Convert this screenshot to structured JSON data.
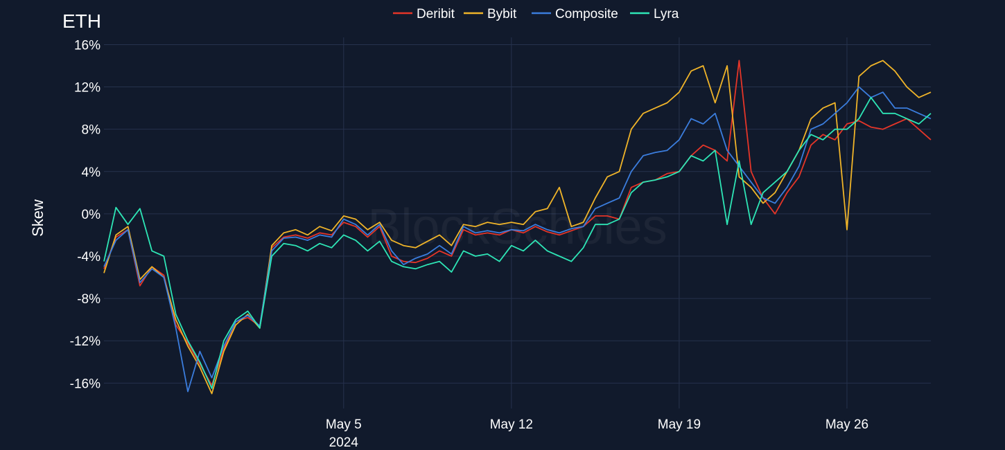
{
  "chart_data": {
    "type": "line",
    "title": "ETH",
    "ylabel": "Skew",
    "xlabel": "",
    "watermark": "BlockScholes",
    "yticks": [
      16,
      12,
      8,
      4,
      0,
      -4,
      -8,
      -12,
      -16
    ],
    "ytick_labels": [
      "16%",
      "12%",
      "8%",
      "4%",
      "0%",
      "-4%",
      "-8%",
      "-12%",
      "-16%"
    ],
    "ylim": [
      -18.4,
      17.6
    ],
    "xlim": [
      "2024-04-25",
      "2024-05-29 12:00"
    ],
    "xticks": [
      {
        "date": "2024-05-05",
        "label": "May 5",
        "sublabel": "2024"
      },
      {
        "date": "2024-05-12",
        "label": "May 12",
        "sublabel": ""
      },
      {
        "date": "2024-05-19",
        "label": "May 19",
        "sublabel": ""
      },
      {
        "date": "2024-05-26",
        "label": "May 26",
        "sublabel": ""
      }
    ],
    "grid": true,
    "legend_position": "top-center",
    "colors": {
      "background": "#111a2c",
      "grid": "#26324d",
      "text": "#ffffff"
    },
    "series": [
      {
        "name": "Deribit",
        "color": "#e53528",
        "x": [
          "2024-04-25",
          "2024-04-25 12:00",
          "2024-04-26",
          "2024-04-26 12:00",
          "2024-04-27",
          "2024-04-27 12:00",
          "2024-04-28",
          "2024-04-28 12:00",
          "2024-04-29",
          "2024-04-29 12:00",
          "2024-04-30",
          "2024-04-30 12:00",
          "2024-05-01",
          "2024-05-01 12:00",
          "2024-05-02",
          "2024-05-02 12:00",
          "2024-05-03",
          "2024-05-03 12:00",
          "2024-05-04",
          "2024-05-04 12:00",
          "2024-05-05",
          "2024-05-05 12:00",
          "2024-05-06",
          "2024-05-06 12:00",
          "2024-05-07",
          "2024-05-07 12:00",
          "2024-05-08",
          "2024-05-08 12:00",
          "2024-05-09",
          "2024-05-09 12:00",
          "2024-05-10",
          "2024-05-10 12:00",
          "2024-05-11",
          "2024-05-11 12:00",
          "2024-05-12",
          "2024-05-12 12:00",
          "2024-05-13",
          "2024-05-13 12:00",
          "2024-05-14",
          "2024-05-14 12:00",
          "2024-05-15",
          "2024-05-15 12:00",
          "2024-05-16",
          "2024-05-16 12:00",
          "2024-05-17",
          "2024-05-17 12:00",
          "2024-05-18",
          "2024-05-18 12:00",
          "2024-05-19",
          "2024-05-19 12:00",
          "2024-05-20",
          "2024-05-20 12:00",
          "2024-05-21",
          "2024-05-21 12:00",
          "2024-05-22",
          "2024-05-22 12:00",
          "2024-05-23",
          "2024-05-23 12:00",
          "2024-05-24",
          "2024-05-24 12:00",
          "2024-05-25",
          "2024-05-25 12:00",
          "2024-05-26",
          "2024-05-26 12:00",
          "2024-05-27",
          "2024-05-27 12:00",
          "2024-05-28",
          "2024-05-28 12:00",
          "2024-05-29",
          "2024-05-29 12:00"
        ],
        "values": [
          -5.2,
          -2.2,
          -1.5,
          -6.8,
          -5.0,
          -5.8,
          -10.5,
          -12.2,
          -14.2,
          -16.2,
          -12.8,
          -10.2,
          -9.8,
          -10.6,
          -3.2,
          -2.2,
          -2.0,
          -2.3,
          -1.8,
          -2.0,
          -0.8,
          -1.2,
          -2.2,
          -1.2,
          -4.0,
          -4.5,
          -4.6,
          -4.2,
          -3.5,
          -4.0,
          -1.5,
          -2.0,
          -1.8,
          -2.0,
          -1.5,
          -1.8,
          -1.2,
          -1.7,
          -2.0,
          -1.6,
          -1.2,
          -0.2,
          -0.2,
          -0.5,
          2.5,
          3.0,
          3.2,
          3.8,
          4.0,
          5.5,
          6.5,
          6.0,
          5.0,
          14.5,
          4.0,
          1.5,
          0.0,
          2.0,
          3.5,
          6.5,
          7.5,
          7.0,
          8.5,
          8.8,
          8.2,
          8.0,
          8.5,
          9.0,
          8.0,
          7.0
        ]
      },
      {
        "name": "Bybit",
        "color": "#f0b429",
        "x": [
          "2024-04-25",
          "2024-04-25 12:00",
          "2024-04-26",
          "2024-04-26 12:00",
          "2024-04-27",
          "2024-04-27 12:00",
          "2024-04-28",
          "2024-04-28 12:00",
          "2024-04-29",
          "2024-04-29 12:00",
          "2024-04-30",
          "2024-04-30 12:00",
          "2024-05-01",
          "2024-05-01 12:00",
          "2024-05-02",
          "2024-05-02 12:00",
          "2024-05-03",
          "2024-05-03 12:00",
          "2024-05-04",
          "2024-05-04 12:00",
          "2024-05-05",
          "2024-05-05 12:00",
          "2024-05-06",
          "2024-05-06 12:00",
          "2024-05-07",
          "2024-05-07 12:00",
          "2024-05-08",
          "2024-05-08 12:00",
          "2024-05-09",
          "2024-05-09 12:00",
          "2024-05-10",
          "2024-05-10 12:00",
          "2024-05-11",
          "2024-05-11 12:00",
          "2024-05-12",
          "2024-05-12 12:00",
          "2024-05-13",
          "2024-05-13 12:00",
          "2024-05-14",
          "2024-05-14 12:00",
          "2024-05-15",
          "2024-05-15 12:00",
          "2024-05-16",
          "2024-05-16 12:00",
          "2024-05-17",
          "2024-05-17 12:00",
          "2024-05-18",
          "2024-05-18 12:00",
          "2024-05-19",
          "2024-05-19 12:00",
          "2024-05-20",
          "2024-05-20 12:00",
          "2024-05-21",
          "2024-05-21 12:00",
          "2024-05-22",
          "2024-05-22 12:00",
          "2024-05-23",
          "2024-05-23 12:00",
          "2024-05-24",
          "2024-05-24 12:00",
          "2024-05-25",
          "2024-05-25 12:00",
          "2024-05-26",
          "2024-05-26 12:00",
          "2024-05-27",
          "2024-05-27 12:00",
          "2024-05-28",
          "2024-05-28 12:00",
          "2024-05-29",
          "2024-05-29 12:00"
        ],
        "values": [
          -5.6,
          -2.0,
          -1.2,
          -6.2,
          -5.0,
          -6.0,
          -10.0,
          -12.5,
          -14.5,
          -17.0,
          -13.0,
          -10.5,
          -9.5,
          -10.8,
          -3.0,
          -1.8,
          -1.5,
          -2.0,
          -1.2,
          -1.6,
          -0.2,
          -0.5,
          -1.5,
          -0.8,
          -2.5,
          -3.0,
          -3.2,
          -2.6,
          -2.0,
          -3.0,
          -1.0,
          -1.2,
          -0.8,
          -1.0,
          -0.8,
          -1.0,
          0.2,
          0.5,
          2.5,
          -1.2,
          -0.8,
          1.5,
          3.5,
          4.0,
          8.0,
          9.5,
          10.0,
          10.5,
          11.5,
          13.5,
          14.0,
          10.5,
          14.0,
          3.5,
          2.5,
          1.0,
          2.0,
          4.0,
          6.0,
          9.0,
          10.0,
          10.5,
          -1.5,
          13.0,
          14.0,
          14.5,
          13.5,
          12.0,
          11.0,
          11.5
        ]
      },
      {
        "name": "Composite",
        "color": "#3b7ddd",
        "x": [
          "2024-04-25",
          "2024-04-25 12:00",
          "2024-04-26",
          "2024-04-26 12:00",
          "2024-04-27",
          "2024-04-27 12:00",
          "2024-04-28",
          "2024-04-28 12:00",
          "2024-04-29",
          "2024-04-29 12:00",
          "2024-04-30",
          "2024-04-30 12:00",
          "2024-05-01",
          "2024-05-01 12:00",
          "2024-05-02",
          "2024-05-02 12:00",
          "2024-05-03",
          "2024-05-03 12:00",
          "2024-05-04",
          "2024-05-04 12:00",
          "2024-05-05",
          "2024-05-05 12:00",
          "2024-05-06",
          "2024-05-06 12:00",
          "2024-05-07",
          "2024-05-07 12:00",
          "2024-05-08",
          "2024-05-08 12:00",
          "2024-05-09",
          "2024-05-09 12:00",
          "2024-05-10",
          "2024-05-10 12:00",
          "2024-05-11",
          "2024-05-11 12:00",
          "2024-05-12",
          "2024-05-12 12:00",
          "2024-05-13",
          "2024-05-13 12:00",
          "2024-05-14",
          "2024-05-14 12:00",
          "2024-05-15",
          "2024-05-15 12:00",
          "2024-05-16",
          "2024-05-16 12:00",
          "2024-05-17",
          "2024-05-17 12:00",
          "2024-05-18",
          "2024-05-18 12:00",
          "2024-05-19",
          "2024-05-19 12:00",
          "2024-05-20",
          "2024-05-20 12:00",
          "2024-05-21",
          "2024-05-21 12:00",
          "2024-05-22",
          "2024-05-22 12:00",
          "2024-05-23",
          "2024-05-23 12:00",
          "2024-05-24",
          "2024-05-24 12:00",
          "2024-05-25",
          "2024-05-25 12:00",
          "2024-05-26",
          "2024-05-26 12:00",
          "2024-05-27",
          "2024-05-27 12:00",
          "2024-05-28",
          "2024-05-28 12:00",
          "2024-05-29",
          "2024-05-29 12:00"
        ],
        "values": [
          -5.0,
          -2.5,
          -1.5,
          -6.5,
          -5.2,
          -6.0,
          -10.8,
          -16.8,
          -13.0,
          -15.5,
          -12.5,
          -10.2,
          -9.6,
          -10.6,
          -3.5,
          -2.3,
          -2.2,
          -2.5,
          -2.0,
          -2.2,
          -0.5,
          -1.0,
          -2.0,
          -1.0,
          -3.5,
          -4.8,
          -4.2,
          -3.8,
          -3.0,
          -3.8,
          -1.2,
          -1.8,
          -1.6,
          -1.8,
          -1.5,
          -1.6,
          -1.0,
          -1.5,
          -1.8,
          -1.4,
          -1.2,
          0.5,
          1.0,
          1.5,
          4.0,
          5.5,
          5.8,
          6.0,
          7.0,
          9.0,
          8.5,
          9.5,
          6.0,
          4.5,
          3.0,
          1.5,
          1.0,
          2.5,
          4.5,
          8.0,
          8.5,
          9.5,
          10.5,
          12.0,
          11.0,
          11.5,
          10.0,
          10.0,
          9.5,
          9.0
        ]
      },
      {
        "name": "Lyra",
        "color": "#2ee6b6",
        "x": [
          "2024-04-25",
          "2024-04-25 12:00",
          "2024-04-26",
          "2024-04-26 12:00",
          "2024-04-27",
          "2024-04-27 12:00",
          "2024-04-28",
          "2024-04-28 12:00",
          "2024-04-29",
          "2024-04-29 12:00",
          "2024-04-30",
          "2024-04-30 12:00",
          "2024-05-01",
          "2024-05-01 12:00",
          "2024-05-02",
          "2024-05-02 12:00",
          "2024-05-03",
          "2024-05-03 12:00",
          "2024-05-04",
          "2024-05-04 12:00",
          "2024-05-05",
          "2024-05-05 12:00",
          "2024-05-06",
          "2024-05-06 12:00",
          "2024-05-07",
          "2024-05-07 12:00",
          "2024-05-08",
          "2024-05-08 12:00",
          "2024-05-09",
          "2024-05-09 12:00",
          "2024-05-10",
          "2024-05-10 12:00",
          "2024-05-11",
          "2024-05-11 12:00",
          "2024-05-12",
          "2024-05-12 12:00",
          "2024-05-13",
          "2024-05-13 12:00",
          "2024-05-14",
          "2024-05-14 12:00",
          "2024-05-15",
          "2024-05-15 12:00",
          "2024-05-16",
          "2024-05-16 12:00",
          "2024-05-17",
          "2024-05-17 12:00",
          "2024-05-18",
          "2024-05-18 12:00",
          "2024-05-19",
          "2024-05-19 12:00",
          "2024-05-20",
          "2024-05-20 12:00",
          "2024-05-21",
          "2024-05-21 12:00",
          "2024-05-22",
          "2024-05-22 12:00",
          "2024-05-23",
          "2024-05-23 12:00",
          "2024-05-24",
          "2024-05-24 12:00",
          "2024-05-25",
          "2024-05-25 12:00",
          "2024-05-26",
          "2024-05-26 12:00",
          "2024-05-27",
          "2024-05-27 12:00",
          "2024-05-28",
          "2024-05-28 12:00",
          "2024-05-29",
          "2024-05-29 12:00"
        ],
        "values": [
          -4.5,
          0.6,
          -1.0,
          0.5,
          -3.5,
          -4.0,
          -9.5,
          -12.0,
          -14.0,
          -16.5,
          -12.0,
          -10.0,
          -9.2,
          -10.8,
          -4.0,
          -2.8,
          -3.0,
          -3.5,
          -2.8,
          -3.2,
          -2.0,
          -2.5,
          -3.5,
          -2.6,
          -4.5,
          -5.0,
          -5.2,
          -4.8,
          -4.5,
          -5.5,
          -3.5,
          -4.0,
          -3.8,
          -4.5,
          -3.0,
          -3.5,
          -2.5,
          -3.5,
          -4.0,
          -4.5,
          -3.2,
          -1.0,
          -1.0,
          -0.5,
          2.0,
          3.0,
          3.2,
          3.5,
          4.0,
          5.5,
          5.0,
          6.0,
          -1.0,
          5.0,
          -1.0,
          2.0,
          3.0,
          4.0,
          6.0,
          7.5,
          7.0,
          8.0,
          8.0,
          9.0,
          11.0,
          9.5,
          9.5,
          9.0,
          8.5,
          9.5
        ]
      }
    ]
  }
}
